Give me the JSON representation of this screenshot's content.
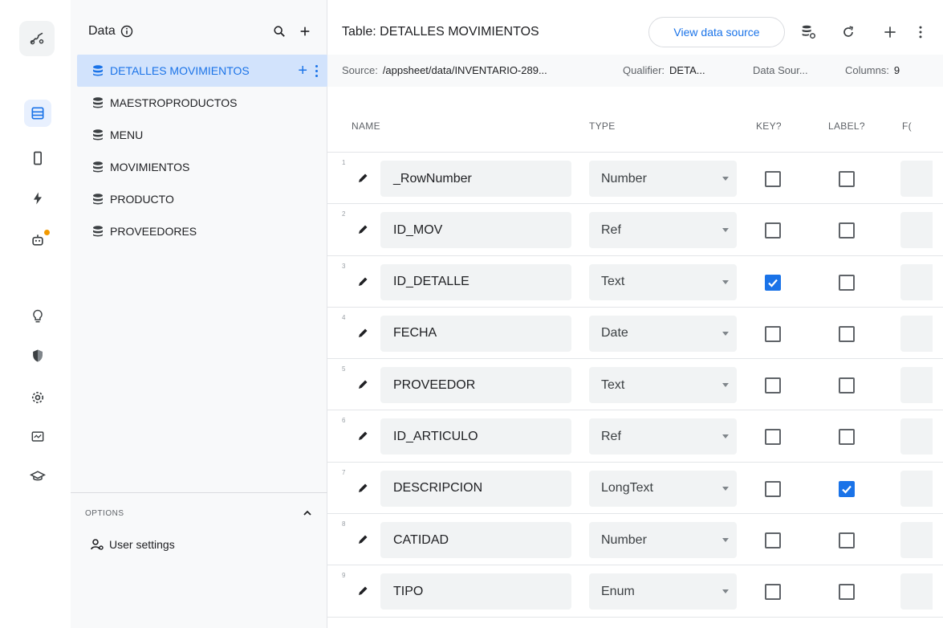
{
  "rail": {
    "items": [
      {
        "name": "flow-icon",
        "active": false
      },
      {
        "name": "data-table-icon",
        "active": true
      },
      {
        "name": "phone-icon",
        "active": false
      },
      {
        "name": "lightning-icon",
        "active": false
      },
      {
        "name": "robot-icon",
        "active": false,
        "badge": true
      },
      {
        "name": "lightbulb-icon",
        "active": false
      },
      {
        "name": "shield-icon",
        "active": false
      },
      {
        "name": "gear-icon",
        "active": false
      },
      {
        "name": "monitor-icon",
        "active": false
      },
      {
        "name": "graduation-cap-icon",
        "active": false
      }
    ]
  },
  "data_panel": {
    "title": "Data",
    "tables": [
      {
        "label": "DETALLES MOVIMIENTOS",
        "selected": true
      },
      {
        "label": "MAESTROPRODUCTOS",
        "selected": false
      },
      {
        "label": "MENU",
        "selected": false
      },
      {
        "label": "MOVIMIENTOS",
        "selected": false
      },
      {
        "label": "PRODUCTO",
        "selected": false
      },
      {
        "label": "PROVEEDORES",
        "selected": false
      }
    ],
    "options": {
      "label": "OPTIONS",
      "user_settings": "User settings"
    }
  },
  "main": {
    "table_title": "Table: DETALLES MOVIMIENTOS",
    "view_data_source": "View data source",
    "source_bar": {
      "source_label": "Source:",
      "source_value": "/appsheet/data/INVENTARIO-289...",
      "qualifier_label": "Qualifier:",
      "qualifier_value": "DETA...",
      "data_source": "Data Sour...",
      "columns_label": "Columns:",
      "columns_value": "9"
    },
    "headers": {
      "name": "NAME",
      "type": "TYPE",
      "key": "KEY?",
      "label": "LABEL?",
      "formula": "F("
    },
    "columns": [
      {
        "num": "1",
        "name": "_RowNumber",
        "type": "Number",
        "key": false,
        "label": false
      },
      {
        "num": "2",
        "name": "ID_MOV",
        "type": "Ref",
        "key": false,
        "label": false
      },
      {
        "num": "3",
        "name": "ID_DETALLE",
        "type": "Text",
        "key": true,
        "label": false
      },
      {
        "num": "4",
        "name": "FECHA",
        "type": "Date",
        "key": false,
        "label": false
      },
      {
        "num": "5",
        "name": "PROVEEDOR",
        "type": "Text",
        "key": false,
        "label": false
      },
      {
        "num": "6",
        "name": "ID_ARTICULO",
        "type": "Ref",
        "key": false,
        "label": false
      },
      {
        "num": "7",
        "name": "DESCRIPCION",
        "type": "LongText",
        "key": false,
        "label": true
      },
      {
        "num": "8",
        "name": "CATIDAD",
        "type": "Number",
        "key": false,
        "label": false
      },
      {
        "num": "9",
        "name": "TIPO",
        "type": "Enum",
        "key": false,
        "label": false
      }
    ],
    "colors": {
      "accent": "#1a73e8",
      "selected_bg": "#d2e3fc",
      "field_bg": "#f1f3f4"
    }
  }
}
